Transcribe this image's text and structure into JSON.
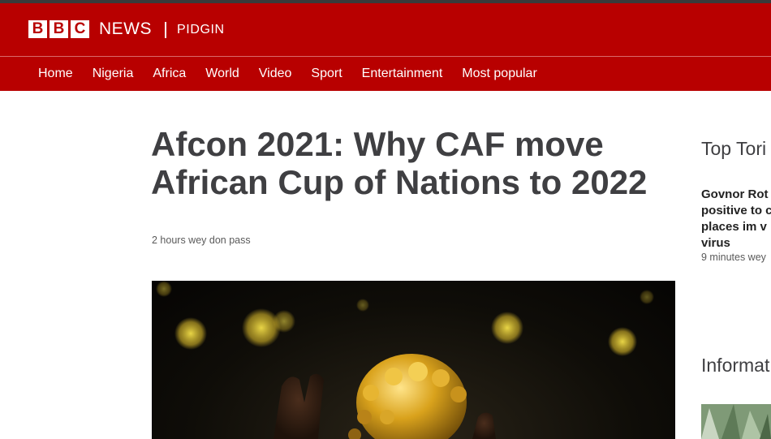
{
  "brand": {
    "logo_letters": [
      "B",
      "B",
      "C"
    ],
    "news_label": "NEWS",
    "section_label": "PIDGIN",
    "accent_color": "#b80000"
  },
  "nav": {
    "items": [
      "Home",
      "Nigeria",
      "Africa",
      "World",
      "Video",
      "Sport",
      "Entertainment",
      "Most popular"
    ],
    "active_index": 0
  },
  "article": {
    "headline": "Afcon 2021: Why CAF move African Cup of Nations to 2022",
    "timestamp": "2 hours wey don pass",
    "hero_image_icon": "afcon-trophy-image"
  },
  "rail": {
    "section_title": "Top Tori",
    "top_story": {
      "headline": "Govnor Rot positive to c places im v virus",
      "time": "9 minutes wey"
    },
    "section_title_2": "Informat"
  }
}
